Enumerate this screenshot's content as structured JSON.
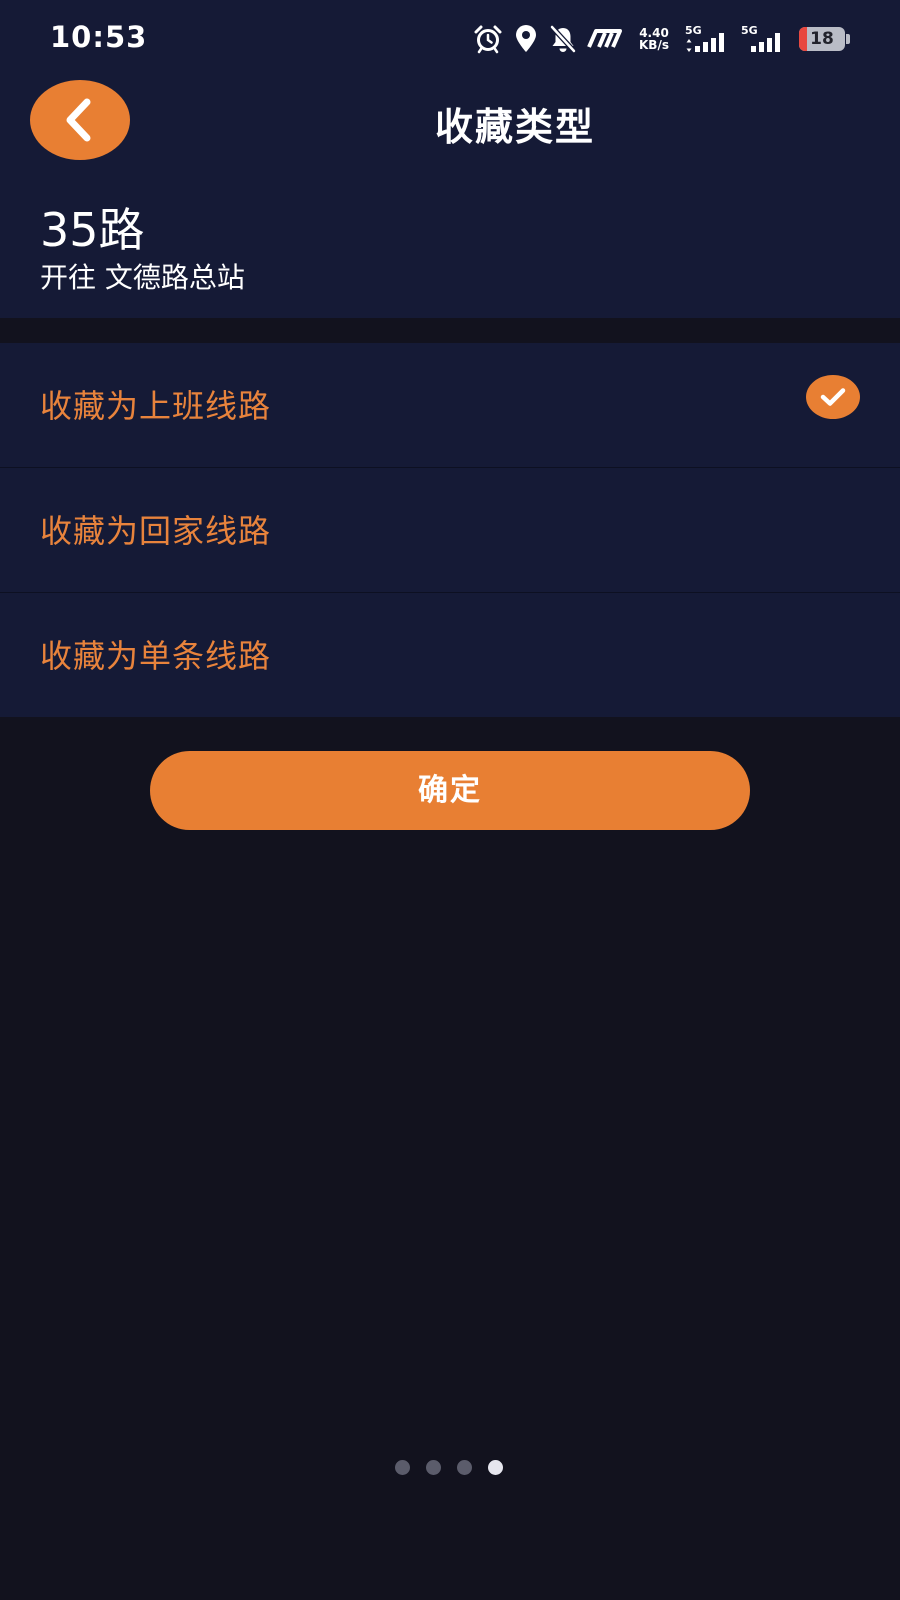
{
  "status_bar": {
    "time": "10:53",
    "net_speed_value": "4.40",
    "net_speed_unit": "KB/s",
    "sim1_label": "5G",
    "sim2_label": "5G",
    "battery_level": "18",
    "icons": [
      "alarm-icon",
      "location-icon",
      "mute-icon",
      "nfc-icon",
      "net-speed",
      "signal-icon",
      "signal-icon",
      "battery-icon"
    ]
  },
  "header": {
    "title": "收藏类型",
    "back_icon": "chevron-left-icon"
  },
  "route": {
    "number": "35路",
    "direction": "开往 文德路总站"
  },
  "options": [
    {
      "label": "收藏为上班线路",
      "selected": true
    },
    {
      "label": "收藏为回家线路",
      "selected": false
    },
    {
      "label": "收藏为单条线路",
      "selected": false
    }
  ],
  "confirm_label": "确定",
  "pagination": {
    "total": 4,
    "active": 4
  },
  "colors": {
    "accent": "#e87f33",
    "header_bg": "#151a36",
    "page_bg": "#12121e",
    "option_text": "#e8833c",
    "battery_low": "#e8473f"
  }
}
